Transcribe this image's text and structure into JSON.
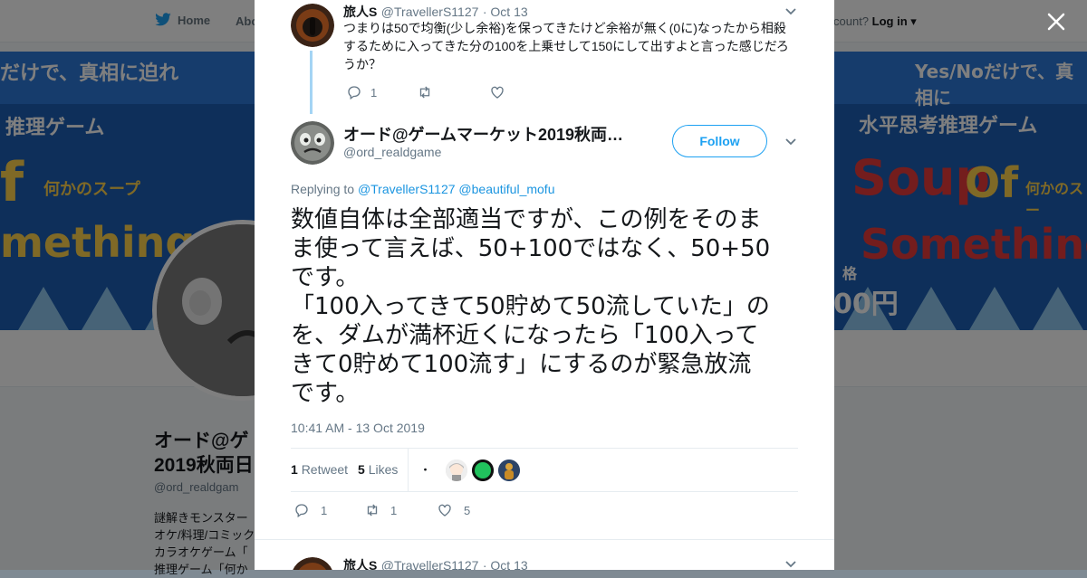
{
  "background": {
    "nav": {
      "home_label": "Home",
      "about_label": "Abo",
      "account_text": "count?",
      "login_label": "Log in"
    },
    "banner": {
      "left_headline": "だけで、真相に迫れ",
      "left_subtitle": "推理ゲーム",
      "left_of": "f",
      "left_soup": "何かのスープ",
      "left_something": "mething",
      "right_headline": "Yes/Noだけで、真相に",
      "right_subtitle": "水平思考推理ゲーム",
      "right_soup_word": "Soup",
      "right_of": "Of",
      "right_soup": "何かのスー",
      "right_something": "Something",
      "price_label": "格",
      "price_value": "00円"
    },
    "profile": {
      "name_line1": "オード@ゲ",
      "name_line2": "2019秋両日",
      "handle": "@ord_realdgam",
      "bio_lines": [
        "謎解きモンスター",
        "オケ/料理/コミック",
        "カラオケゲーム「",
        "推理ゲーム「何か"
      ]
    }
  },
  "parent_tweet": {
    "name": "旅人S",
    "handle": "@TravellerS1127",
    "date": "· Oct 13",
    "text": "つまりは50で均衡(少し余裕)を保ってきたけど余裕が無く(0に)なったから相殺するために入ってきた分の100を上乗せして150にして出すよと言った感じだろうか？",
    "reply_count": "1",
    "retweet_count": "",
    "like_count": ""
  },
  "main_tweet": {
    "display_name": "オード@ゲームマーケット2019秋両…",
    "handle": "@ord_realdgame",
    "follow_label": "Follow",
    "replying_prefix": "Replying to",
    "replying_to_1": "@TravellerS1127",
    "replying_to_2": "@beautiful_mofu",
    "text_lines": [
      "数値自体は全部適当ですが、この例をそのま",
      "ま使って言えば、50+100ではなく、50+50",
      "です。",
      "「100入ってきて50貯めて50流していた」の",
      "を、ダムが満杯近くになったら「100入って",
      "きて0貯めて100流す」にするのが緊急放流",
      "です。"
    ],
    "timestamp": "10:41 AM - 13 Oct 2019",
    "stats": {
      "retweet_count": "1",
      "retweet_label": "Retweet",
      "like_count": "5",
      "like_label": "Likes"
    },
    "likers": [
      "kaomoji-avatar",
      "anime-girl-avatar",
      "green-circle-avatar",
      "golden-figure-avatar"
    ],
    "liker_kaomoji": "・ω・",
    "actions": {
      "reply_count": "1",
      "retweet_count": "1",
      "like_count": "5"
    }
  },
  "next_tweet": {
    "name": "旅人S",
    "handle": "@TravellerS1127",
    "date": "· Oct 13"
  },
  "colors": {
    "twitter_blue": "#1da1f2",
    "link_blue": "#1b95e0",
    "thread_line": "#a4d4f4",
    "text_primary": "#14171a",
    "text_muted": "#657786"
  }
}
